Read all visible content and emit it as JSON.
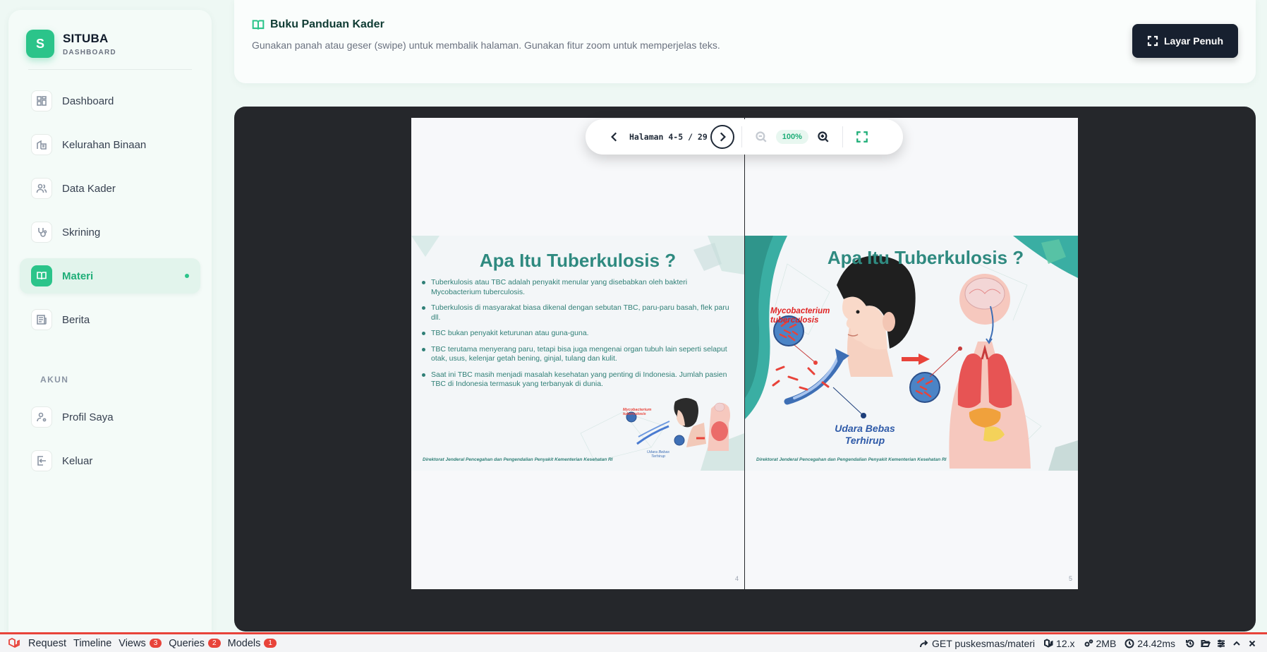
{
  "brand": {
    "logo_letter": "S",
    "name": "SITUBA",
    "sub": "DASHBOARD"
  },
  "sidebar": {
    "items": [
      {
        "label": "Dashboard",
        "icon": "dashboard-icon"
      },
      {
        "label": "Kelurahan Binaan",
        "icon": "building-icon"
      },
      {
        "label": "Data Kader",
        "icon": "users-icon"
      },
      {
        "label": "Skrining",
        "icon": "stethoscope-icon"
      },
      {
        "label": "Materi",
        "icon": "book-icon",
        "active": true
      },
      {
        "label": "Berita",
        "icon": "news-icon"
      }
    ],
    "section_title": "AKUN",
    "account_items": [
      {
        "label": "Profil Saya",
        "icon": "user-settings-icon"
      },
      {
        "label": "Keluar",
        "icon": "logout-icon"
      }
    ]
  },
  "header": {
    "title": "Buku Panduan Kader",
    "description": "Gunakan panah atau geser (swipe) untuk membalik halaman. Gunakan fitur zoom untuk memperjelas teks.",
    "fullscreen_label": "Layar Penuh"
  },
  "toolbar": {
    "page_indicator": "Halaman 4-5 / 29",
    "zoom": "100%"
  },
  "book": {
    "left": {
      "page_number": "4",
      "title": "Apa Itu Tuberkulosis ?",
      "bullets": [
        "Tuberkulosis atau TBC adalah penyakit menular yang disebabkan oleh bakteri Mycobacterium tuberculosis.",
        "Tuberkulosis di masyarakat biasa dikenal dengan sebutan TBC, paru-paru basah, flek paru dll.",
        "TBC bukan penyakit keturunan atau guna-guna.",
        "TBC terutama menyerang paru, tetapi bisa juga mengenai organ tubuh lain seperti selaput otak, usus, kelenjar getah bening, ginjal, tulang dan kulit.",
        "Saat ini TBC masih menjadi masalah kesehatan yang penting di Indonesia. Jumlah pasien TBC di Indonesia termasuk yang terbanyak di dunia."
      ],
      "footer": "Direktorat Jenderal Pencegahan dan Pengendalian Penyakit Kementerian Kesehatan RI",
      "mini_label_bacteria": "Mycobacterium tuberculosis",
      "mini_label_air": "Udara Bebas Terhirup"
    },
    "right": {
      "page_number": "5",
      "title": "Apa Itu Tuberkulosis ?",
      "label_bacteria": "Mycobacterium tuberculosis",
      "label_air": "Udara Bebas Terhirup",
      "footer": "Direktorat Jenderal Pencegahan dan Pengendalian Penyakit Kementerian Kesehatan RI"
    }
  },
  "debugbar": {
    "tabs": [
      {
        "label": "Request"
      },
      {
        "label": "Timeline"
      },
      {
        "label": "Views",
        "badge": "3"
      },
      {
        "label": "Queries",
        "badge": "2"
      },
      {
        "label": "Models",
        "badge": "1"
      }
    ],
    "route": "GET puskesmas/materi",
    "version": "12.x",
    "memory": "2MB",
    "time": "24.42ms"
  }
}
